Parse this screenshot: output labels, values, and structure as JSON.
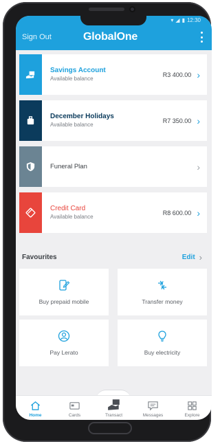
{
  "status_bar": {
    "time": "12:30"
  },
  "header": {
    "sign_out": "Sign Out",
    "brand": "GlobalOne",
    "menu_icon": "more-vertical-icon"
  },
  "accounts": [
    {
      "title": "Savings Account",
      "subtitle": "Available balance",
      "amount": "R3 400.00",
      "color": "#1ea1dd",
      "title_color": "#1ea1dd",
      "icon": "hand-money-icon"
    },
    {
      "title": "December Holidays",
      "subtitle": "Available balance",
      "amount": "R7 350.00",
      "color": "#0b3b5c",
      "title_color": "#0b3b5c",
      "icon": "luggage-icon"
    },
    {
      "title": "Funeral Plan",
      "subtitle": "",
      "amount": "",
      "color": "#6b8493",
      "title_color": "#3c4045",
      "icon": "shield-icon"
    },
    {
      "title": "Credit Card",
      "subtitle": "Available balance",
      "amount": "R8 600.00",
      "color": "#e8453c",
      "title_color": "#e8453c",
      "icon": "credit-card-icon"
    }
  ],
  "favourites": {
    "title": "Favourites",
    "edit": "Edit",
    "items": [
      {
        "label": "Buy prepaid mobile",
        "icon": "mobile-edit-icon"
      },
      {
        "label": "Transfer money",
        "icon": "transfer-icon"
      },
      {
        "label": "Pay Lerato",
        "icon": "person-icon"
      },
      {
        "label": "Buy electricity",
        "icon": "bulb-icon"
      }
    ]
  },
  "tabs": [
    {
      "label": "Home",
      "icon": "home-icon",
      "active": true
    },
    {
      "label": "Cards",
      "icon": "cards-icon",
      "active": false
    },
    {
      "label": "Transact",
      "icon": "transact-icon",
      "active": false
    },
    {
      "label": "Messages",
      "icon": "messages-icon",
      "active": false
    },
    {
      "label": "Explore",
      "icon": "explore-icon",
      "active": false
    }
  ],
  "colors": {
    "primary": "#1ea1dd",
    "background": "#efeff1"
  }
}
